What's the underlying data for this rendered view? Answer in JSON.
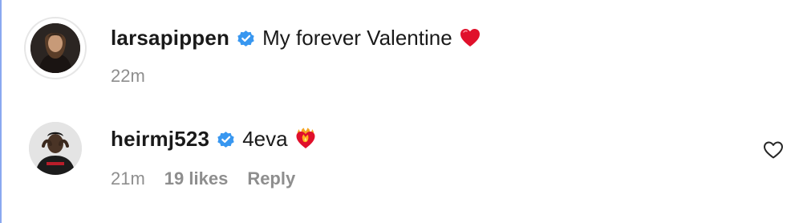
{
  "caption": {
    "username": "larsapippen",
    "verified": true,
    "text": "My forever Valentine",
    "emoji": "red-heart",
    "time": "22m"
  },
  "reply": {
    "username": "heirmj523",
    "verified": true,
    "text": "4eva",
    "emoji": "heart-on-fire",
    "time": "21m",
    "likes": "19 likes",
    "reply_label": "Reply",
    "like_icon": "heart-outline-icon"
  },
  "colors": {
    "verified_blue": "#3897f0",
    "meta_gray": "#8e8e8e",
    "left_rule": "#8aa8f0"
  }
}
